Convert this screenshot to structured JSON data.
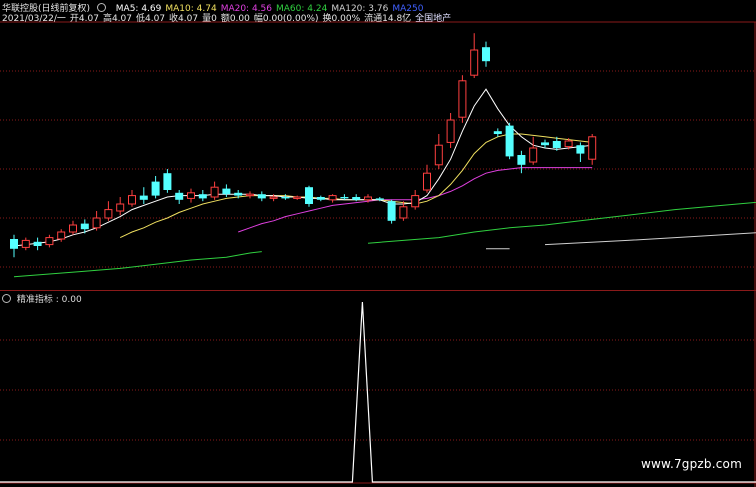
{
  "header": {
    "title": "华联控股(日线前复权)",
    "ma": [
      {
        "label": "MA5: 4.69",
        "cls": "ma5"
      },
      {
        "label": "MA10: 4.74",
        "cls": "ma10"
      },
      {
        "label": "MA20: 4.56",
        "cls": "ma20"
      },
      {
        "label": "MA60: 4.24",
        "cls": "ma60"
      },
      {
        "label": "MA120: 3.76",
        "cls": "ma120"
      },
      {
        "label": "MA250",
        "cls": "ma250"
      }
    ],
    "info": [
      "2021/03/22/一",
      "开4.07",
      "高4.07",
      "低4.07",
      "收4.07",
      "量0",
      "额0.00",
      "幅0.00(0.00%)",
      "换0.00%",
      "流通14.8亿",
      "全国地产"
    ]
  },
  "indicator": {
    "label": "精准指标 : 0.00"
  },
  "watermark": "www.7gpzb.com",
  "colors": {
    "up": "#ff4040",
    "down": "#55ffff",
    "grid": "#8a1a1a",
    "ma5": "#ffffff",
    "ma10": "#f0e060",
    "ma20": "#e040e0",
    "ma60": "#30d040",
    "ma120": "#d0d0d0",
    "indicator": "#ffffff"
  },
  "chart_data": {
    "type": "candlestick",
    "candles": [
      {
        "o": 4.05,
        "c": 3.98,
        "h": 4.08,
        "l": 3.92,
        "dir": "down"
      },
      {
        "o": 3.99,
        "c": 4.04,
        "h": 4.06,
        "l": 3.97,
        "dir": "up"
      },
      {
        "o": 4.03,
        "c": 4.0,
        "h": 4.06,
        "l": 3.97,
        "dir": "down"
      },
      {
        "o": 4.01,
        "c": 4.06,
        "h": 4.08,
        "l": 3.99,
        "dir": "up"
      },
      {
        "o": 4.05,
        "c": 4.1,
        "h": 4.12,
        "l": 4.03,
        "dir": "up"
      },
      {
        "o": 4.1,
        "c": 4.15,
        "h": 4.18,
        "l": 4.08,
        "dir": "up"
      },
      {
        "o": 4.16,
        "c": 4.12,
        "h": 4.19,
        "l": 4.09,
        "dir": "down"
      },
      {
        "o": 4.13,
        "c": 4.2,
        "h": 4.25,
        "l": 4.11,
        "dir": "up"
      },
      {
        "o": 4.2,
        "c": 4.26,
        "h": 4.32,
        "l": 4.18,
        "dir": "up"
      },
      {
        "o": 4.25,
        "c": 4.3,
        "h": 4.35,
        "l": 4.22,
        "dir": "up"
      },
      {
        "o": 4.3,
        "c": 4.36,
        "h": 4.4,
        "l": 4.28,
        "dir": "up"
      },
      {
        "o": 4.36,
        "c": 4.33,
        "h": 4.42,
        "l": 4.3,
        "dir": "down"
      },
      {
        "o": 4.46,
        "c": 4.36,
        "h": 4.5,
        "l": 4.34,
        "dir": "down"
      },
      {
        "o": 4.52,
        "c": 4.4,
        "h": 4.55,
        "l": 4.38,
        "dir": "down"
      },
      {
        "o": 4.38,
        "c": 4.33,
        "h": 4.4,
        "l": 4.3,
        "dir": "down"
      },
      {
        "o": 4.34,
        "c": 4.38,
        "h": 4.41,
        "l": 4.31,
        "dir": "up"
      },
      {
        "o": 4.37,
        "c": 4.34,
        "h": 4.4,
        "l": 4.32,
        "dir": "down"
      },
      {
        "o": 4.35,
        "c": 4.42,
        "h": 4.46,
        "l": 4.33,
        "dir": "up"
      },
      {
        "o": 4.41,
        "c": 4.37,
        "h": 4.44,
        "l": 4.35,
        "dir": "down"
      },
      {
        "o": 4.38,
        "c": 4.36,
        "h": 4.4,
        "l": 4.34,
        "dir": "down"
      },
      {
        "o": 4.36,
        "c": 4.37,
        "h": 4.39,
        "l": 4.34,
        "dir": "up"
      },
      {
        "o": 4.37,
        "c": 4.34,
        "h": 4.39,
        "l": 4.32,
        "dir": "down"
      },
      {
        "o": 4.34,
        "c": 4.35,
        "h": 4.37,
        "l": 4.32,
        "dir": "up"
      },
      {
        "o": 4.35,
        "c": 4.34,
        "h": 4.37,
        "l": 4.33,
        "dir": "down"
      },
      {
        "o": 4.34,
        "c": 4.35,
        "h": 4.36,
        "l": 4.33,
        "dir": "up"
      },
      {
        "o": 4.42,
        "c": 4.3,
        "h": 4.43,
        "l": 4.28,
        "dir": "down"
      },
      {
        "o": 4.35,
        "c": 4.33,
        "h": 4.36,
        "l": 4.32,
        "dir": "down"
      },
      {
        "o": 4.33,
        "c": 4.36,
        "h": 4.37,
        "l": 4.31,
        "dir": "up"
      },
      {
        "o": 4.35,
        "c": 4.34,
        "h": 4.37,
        "l": 4.33,
        "dir": "down"
      },
      {
        "o": 4.35,
        "c": 4.33,
        "h": 4.37,
        "l": 4.32,
        "dir": "down"
      },
      {
        "o": 4.33,
        "c": 4.35,
        "h": 4.37,
        "l": 4.31,
        "dir": "up"
      },
      {
        "o": 4.34,
        "c": 4.33,
        "h": 4.35,
        "l": 4.32,
        "dir": "down"
      },
      {
        "o": 4.32,
        "c": 4.18,
        "h": 4.33,
        "l": 4.16,
        "dir": "down"
      },
      {
        "o": 4.2,
        "c": 4.28,
        "h": 4.32,
        "l": 4.18,
        "dir": "up"
      },
      {
        "o": 4.28,
        "c": 4.36,
        "h": 4.4,
        "l": 4.26,
        "dir": "up"
      },
      {
        "o": 4.4,
        "c": 4.52,
        "h": 4.58,
        "l": 4.38,
        "dir": "up"
      },
      {
        "o": 4.58,
        "c": 4.72,
        "h": 4.8,
        "l": 4.55,
        "dir": "up"
      },
      {
        "o": 4.74,
        "c": 4.9,
        "h": 4.95,
        "l": 4.7,
        "dir": "up"
      },
      {
        "o": 4.92,
        "c": 5.18,
        "h": 5.22,
        "l": 4.88,
        "dir": "up"
      },
      {
        "o": 5.22,
        "c": 5.4,
        "h": 5.52,
        "l": 5.2,
        "dir": "up"
      },
      {
        "o": 5.42,
        "c": 5.32,
        "h": 5.46,
        "l": 5.28,
        "dir": "down"
      },
      {
        "o": 4.82,
        "c": 4.8,
        "h": 4.84,
        "l": 4.78,
        "dir": "down"
      },
      {
        "o": 4.86,
        "c": 4.64,
        "h": 4.88,
        "l": 4.62,
        "dir": "down"
      },
      {
        "o": 4.65,
        "c": 4.58,
        "h": 4.68,
        "l": 4.52,
        "dir": "down"
      },
      {
        "o": 4.6,
        "c": 4.7,
        "h": 4.78,
        "l": 4.58,
        "dir": "up"
      },
      {
        "o": 4.74,
        "c": 4.72,
        "h": 4.76,
        "l": 4.7,
        "dir": "down"
      },
      {
        "o": 4.75,
        "c": 4.7,
        "h": 4.78,
        "l": 4.68,
        "dir": "down"
      },
      {
        "o": 4.71,
        "c": 4.75,
        "h": 4.77,
        "l": 4.69,
        "dir": "up"
      },
      {
        "o": 4.72,
        "c": 4.66,
        "h": 4.74,
        "l": 4.6,
        "dir": "down"
      },
      {
        "o": 4.62,
        "c": 4.78,
        "h": 4.8,
        "l": 4.58,
        "dir": "up"
      }
    ],
    "ma5": [
      4.0,
      4.01,
      4.02,
      4.03,
      4.05,
      4.08,
      4.1,
      4.13,
      4.17,
      4.21,
      4.26,
      4.29,
      4.32,
      4.35,
      4.36,
      4.36,
      4.36,
      4.37,
      4.37,
      4.37,
      4.37,
      4.36,
      4.36,
      4.35,
      4.35,
      4.34,
      4.34,
      4.33,
      4.33,
      4.33,
      4.33,
      4.33,
      4.3,
      4.3,
      4.31,
      4.36,
      4.48,
      4.62,
      4.82,
      5.0,
      5.12,
      4.98,
      4.86,
      4.78,
      4.72,
      4.7,
      4.69,
      4.7,
      4.71,
      4.72
    ],
    "ma10": [
      null,
      null,
      null,
      null,
      null,
      null,
      null,
      null,
      null,
      4.06,
      4.1,
      4.13,
      4.17,
      4.2,
      4.24,
      4.27,
      4.3,
      4.32,
      4.34,
      4.35,
      4.36,
      4.36,
      4.36,
      4.36,
      4.35,
      4.35,
      4.34,
      4.34,
      4.33,
      4.33,
      4.33,
      4.33,
      4.32,
      4.31,
      4.3,
      4.32,
      4.36,
      4.44,
      4.54,
      4.66,
      4.74,
      4.78,
      4.8,
      4.8,
      4.79,
      4.78,
      4.77,
      4.76,
      4.75,
      4.74
    ],
    "ma20": [
      null,
      null,
      null,
      null,
      null,
      null,
      null,
      null,
      null,
      null,
      null,
      null,
      null,
      null,
      null,
      null,
      null,
      null,
      null,
      4.1,
      4.13,
      4.16,
      4.18,
      4.21,
      4.23,
      4.25,
      4.27,
      4.29,
      4.3,
      4.31,
      4.32,
      4.33,
      4.33,
      4.33,
      4.33,
      4.34,
      4.36,
      4.39,
      4.43,
      4.48,
      4.52,
      4.54,
      4.55,
      4.56,
      4.56,
      4.56,
      4.56,
      4.56,
      4.56,
      4.56
    ],
    "ma60_segments": [
      [
        [
          0,
          3.78
        ],
        [
          3,
          3.8
        ],
        [
          6,
          3.82
        ],
        [
          9,
          3.84
        ],
        [
          12,
          3.87
        ],
        [
          15,
          3.9
        ],
        [
          18,
          3.92
        ],
        [
          20,
          3.95
        ],
        [
          21,
          3.96
        ]
      ],
      [
        [
          30,
          4.02
        ],
        [
          33,
          4.04
        ],
        [
          36,
          4.06
        ],
        [
          39,
          4.1
        ],
        [
          42,
          4.13
        ],
        [
          45,
          4.15
        ],
        [
          48,
          4.18
        ],
        [
          52,
          4.22
        ],
        [
          56,
          4.26
        ],
        [
          60,
          4.29
        ],
        [
          64,
          4.32
        ],
        [
          67,
          4.35
        ]
      ]
    ],
    "ma120_segments": [
      [
        [
          40,
          3.98
        ],
        [
          42,
          3.98
        ]
      ],
      [
        [
          45,
          4.01
        ],
        [
          52,
          4.04
        ],
        [
          58,
          4.07
        ],
        [
          64,
          4.1
        ],
        [
          67,
          4.12
        ]
      ]
    ],
    "indicator_values": {
      "spike_index": 28,
      "spike_value": 1.0
    }
  }
}
